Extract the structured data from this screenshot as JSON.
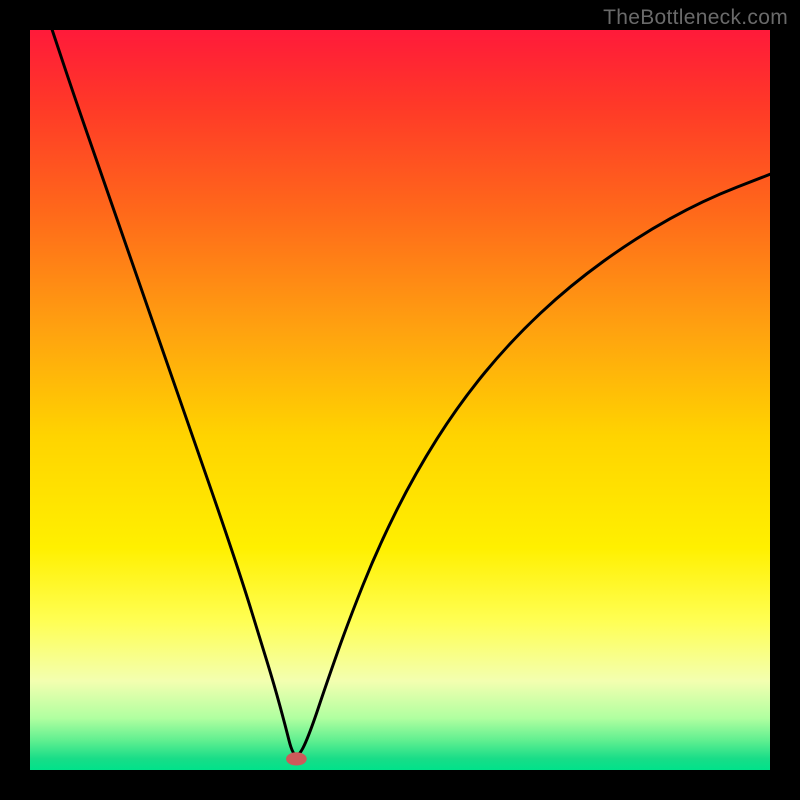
{
  "watermark": {
    "text": "TheBottleneck.com"
  },
  "chart_data": {
    "type": "line",
    "title": "",
    "xlabel": "",
    "ylabel": "",
    "xlim": [
      0,
      100
    ],
    "ylim": [
      0,
      100
    ],
    "grid": false,
    "legend": false,
    "background_gradient": {
      "stops": [
        {
          "pos": 0.0,
          "color": "#ff1a3a"
        },
        {
          "pos": 0.1,
          "color": "#ff3828"
        },
        {
          "pos": 0.25,
          "color": "#ff6a1a"
        },
        {
          "pos": 0.4,
          "color": "#ffa010"
        },
        {
          "pos": 0.55,
          "color": "#ffd400"
        },
        {
          "pos": 0.7,
          "color": "#fff000"
        },
        {
          "pos": 0.8,
          "color": "#ffff55"
        },
        {
          "pos": 0.88,
          "color": "#f3ffb0"
        },
        {
          "pos": 0.93,
          "color": "#b0ffa0"
        },
        {
          "pos": 0.96,
          "color": "#60ef90"
        },
        {
          "pos": 0.985,
          "color": "#18dd88"
        },
        {
          "pos": 1.0,
          "color": "#00e28a"
        }
      ]
    },
    "series": [
      {
        "name": "bottleneck-curve",
        "color": "#000000",
        "x": [
          3.0,
          6.0,
          10.0,
          14.0,
          18.0,
          22.0,
          26.0,
          29.0,
          31.0,
          33.0,
          34.5,
          35.5,
          36.5,
          38.0,
          40.0,
          43.0,
          47.0,
          52.0,
          58.0,
          65.0,
          73.0,
          82.0,
          91.0,
          100.0
        ],
        "y": [
          100.0,
          91.0,
          79.5,
          68.0,
          56.5,
          45.0,
          33.5,
          24.5,
          18.0,
          11.5,
          6.0,
          2.0,
          2.0,
          5.5,
          11.5,
          20.0,
          30.0,
          40.0,
          49.5,
          58.0,
          65.5,
          72.0,
          77.0,
          80.5
        ]
      }
    ],
    "marker": {
      "name": "optimal-point",
      "x": 36.0,
      "y": 1.5,
      "rx": 1.4,
      "ry": 0.9,
      "color": "#cc5a5a"
    }
  }
}
